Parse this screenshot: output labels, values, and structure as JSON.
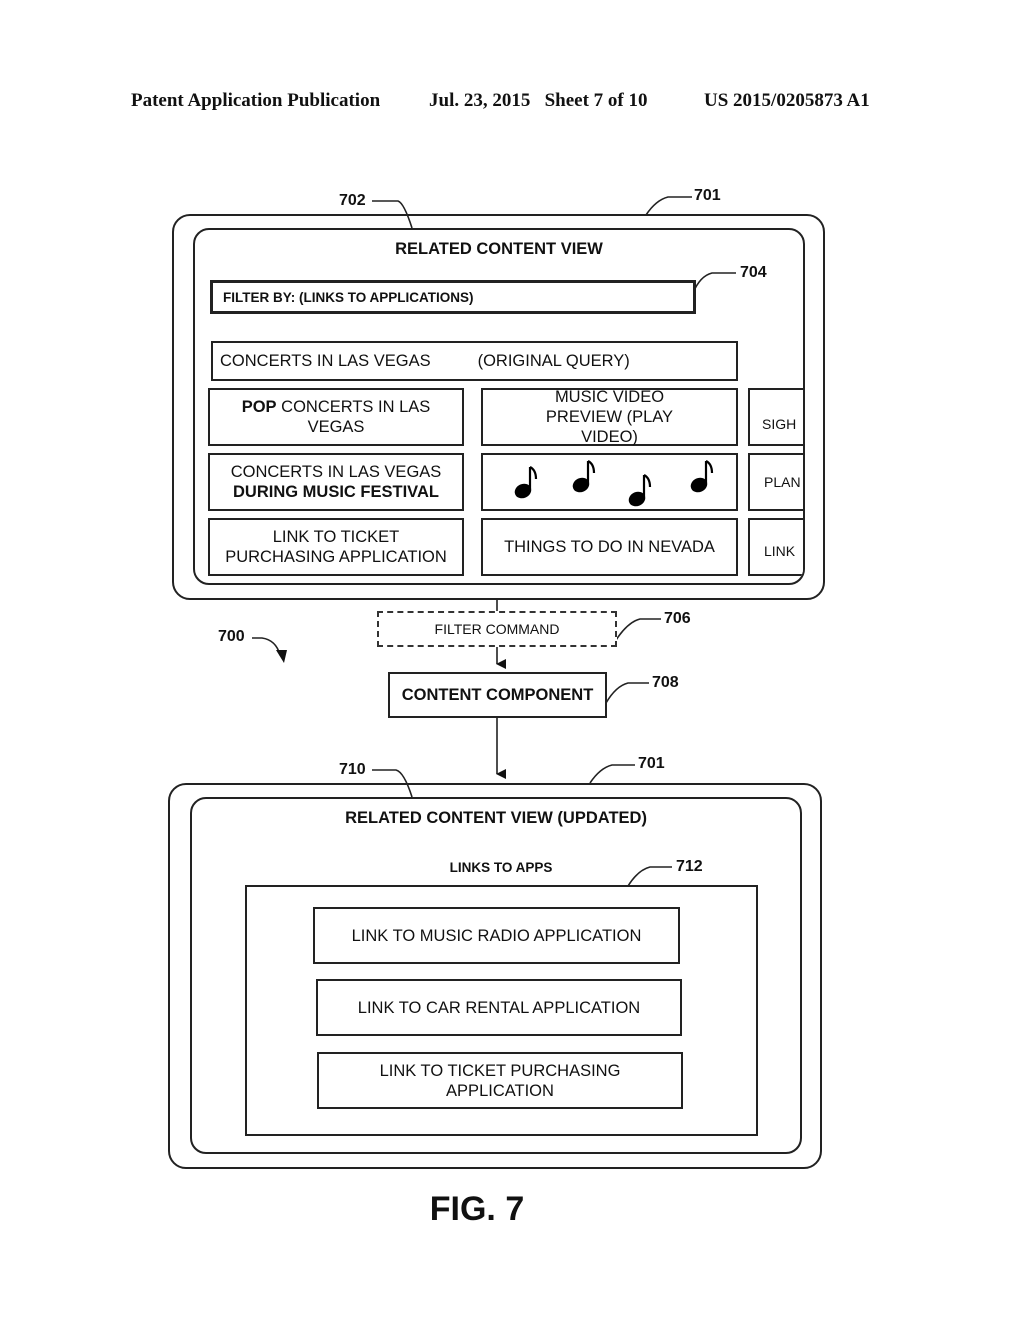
{
  "header": {
    "publication": "Patent Application Publication",
    "date_sheet": "Jul. 23, 2015   Sheet 7 of 10",
    "patent_number": "US 2015/0205873 A1"
  },
  "figure_label": "FIG. 7",
  "refs": {
    "r700": "700",
    "r701_top": "701",
    "r702": "702",
    "r704": "704",
    "r706": "706",
    "r708": "708",
    "r701_bottom": "701",
    "r710": "710",
    "r712": "712"
  },
  "top_view": {
    "title": "RELATED CONTENT VIEW",
    "filter_label": "FILTER BY: (LINKS TO APPLICATIONS)",
    "query_text": "CONCERTS IN LAS VEGAS",
    "query_note": "(ORIGINAL QUERY)",
    "cards": {
      "pop_bold": "POP",
      "pop_rest": " CONCERTS IN LAS VEGAS",
      "music_video": "MUSIC VIDEO PREVIEW (PLAY VIDEO)",
      "festival_line1": "CONCERTS IN LAS VEGAS",
      "festival_line2": "DURING MUSIC FESTIVAL",
      "music_notes_icon": "♪",
      "ticket_link": "LINK TO TICKET PURCHASING APPLICATION",
      "things_to_do": "THINGS TO DO IN NEVADA",
      "side1": "SIGH",
      "side2": "PLAN",
      "side3": "LINK"
    }
  },
  "filter_command": "FILTER COMMAND",
  "content_component": "CONTENT COMPONENT",
  "bottom_view": {
    "title": "RELATED CONTENT VIEW (UPDATED)",
    "section_label": "LINKS TO APPS",
    "links": [
      "LINK TO MUSIC RADIO APPLICATION",
      "LINK TO CAR RENTAL APPLICATION",
      "LINK TO TICKET PURCHASING APPLICATION"
    ]
  }
}
